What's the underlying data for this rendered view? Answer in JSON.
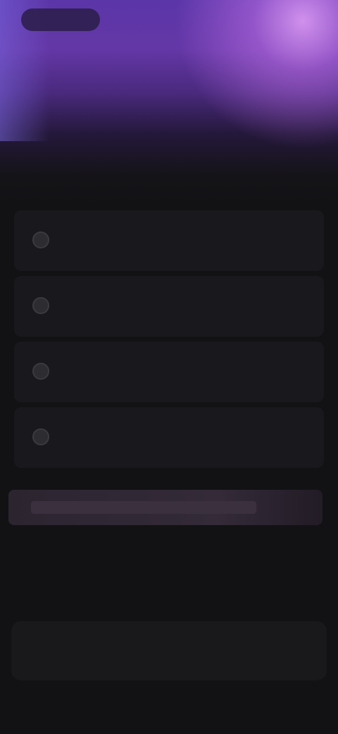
{
  "header": {
    "back_label": ""
  },
  "question": {
    "title": ""
  },
  "options": [
    {
      "label": ""
    },
    {
      "label": ""
    },
    {
      "label": ""
    },
    {
      "label": ""
    }
  ],
  "hint": {
    "text": ""
  },
  "footer": {
    "continue_label": ""
  },
  "colors": {
    "accent_purple": "#6437a6",
    "highlight_pink": "#d696f0",
    "background": "#121214",
    "card": "#19191d"
  }
}
